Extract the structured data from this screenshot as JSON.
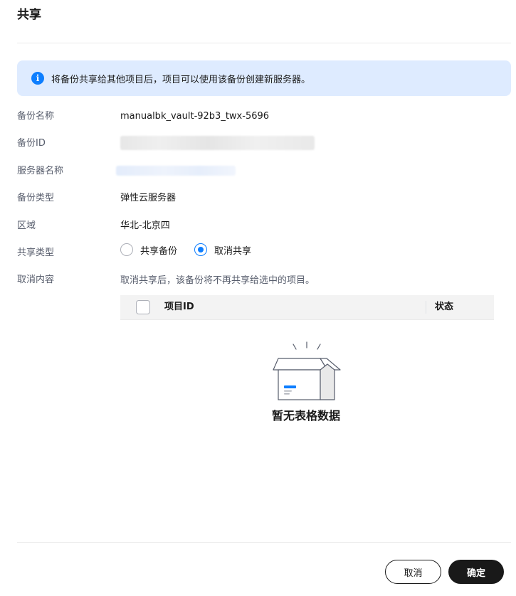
{
  "dialog": {
    "title": "共享",
    "info_message": "将备份共享给其他项目后，项目可以使用该备份创建新服务器。"
  },
  "fields": {
    "backup_name": {
      "label": "备份名称",
      "value": "manualbk_vault-92b3_twx-5696"
    },
    "backup_id": {
      "label": "备份ID"
    },
    "server_name": {
      "label": "服务器名称"
    },
    "backup_type": {
      "label": "备份类型",
      "value": "弹性云服务器"
    },
    "region": {
      "label": "区域",
      "value": "华北-北京四"
    },
    "share_type": {
      "label": "共享类型",
      "options": [
        {
          "label": "共享备份",
          "checked": false
        },
        {
          "label": "取消共享",
          "checked": true
        }
      ]
    },
    "cancel_content": {
      "label": "取消内容",
      "description": "取消共享后，该备份将不再共享给选中的项目。"
    }
  },
  "table": {
    "columns": [
      "项目ID",
      "状态"
    ],
    "rows": [],
    "empty_text": "暂无表格数据"
  },
  "footer": {
    "cancel_label": "取消",
    "confirm_label": "确定"
  },
  "colors": {
    "accent": "#0d7eff",
    "info_bg": "#deebff",
    "primary_button": "#191919"
  }
}
